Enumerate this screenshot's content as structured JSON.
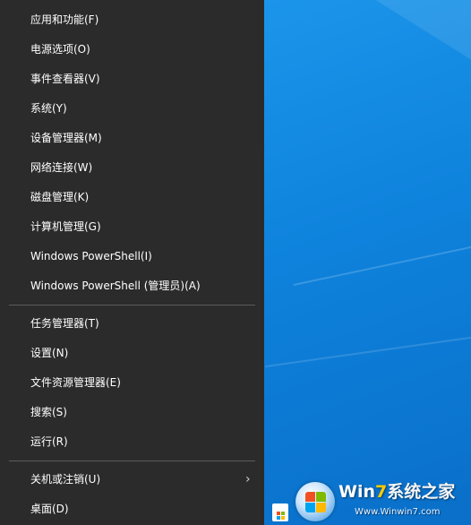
{
  "menu": {
    "group1": [
      "应用和功能(F)",
      "电源选项(O)",
      "事件查看器(V)",
      "系统(Y)",
      "设备管理器(M)",
      "网络连接(W)",
      "磁盘管理(K)",
      "计算机管理(G)",
      "Windows PowerShell(I)",
      "Windows PowerShell (管理员)(A)"
    ],
    "group2": [
      "任务管理器(T)",
      "设置(N)",
      "文件资源管理器(E)",
      "搜索(S)",
      "运行(R)"
    ],
    "group3": [
      "关机或注销(U)",
      "桌面(D)"
    ],
    "submenu_icon": "chevron-right-icon"
  },
  "watermark": {
    "title_win": "Win",
    "title_ten": "7",
    "title_rest": "系统之家",
    "url": "Www.Winwin7.com"
  },
  "taskbar": {
    "store_icon": "microsoft-store-icon"
  },
  "colors": {
    "menu_bg": "#2b2b2b",
    "desktop_blue": "#0e82dc",
    "separator": "#5c5c5c"
  }
}
